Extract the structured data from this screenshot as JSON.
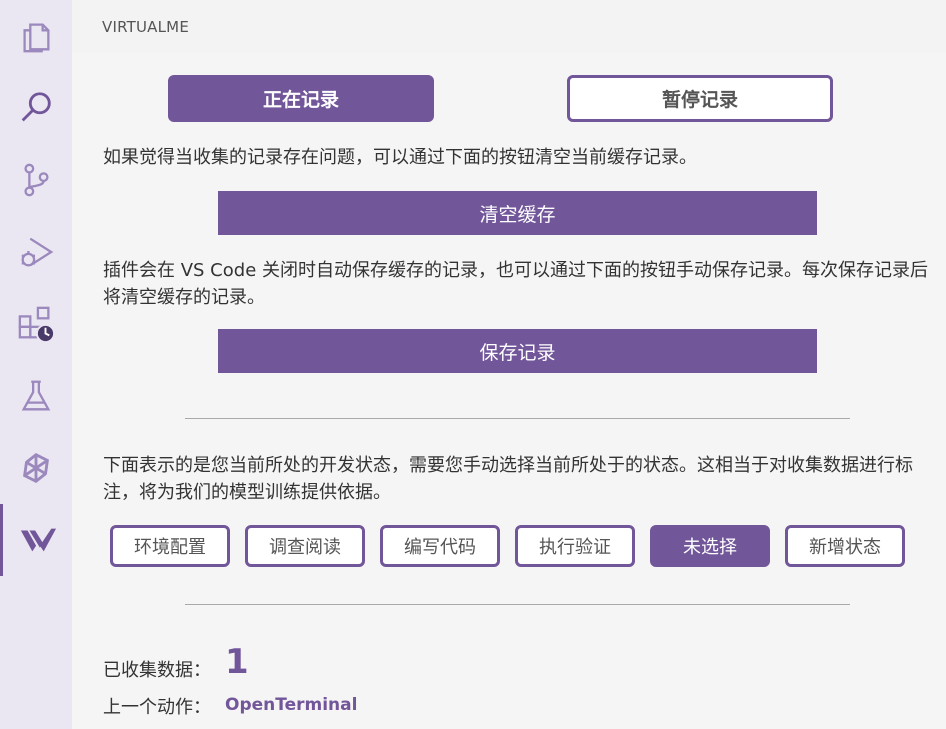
{
  "panel": {
    "title": "VIRTUALME"
  },
  "recording": {
    "start_label": "正在记录",
    "pause_label": "暂停记录"
  },
  "clear": {
    "description": "如果觉得当收集的记录存在问题，可以通过下面的按钮清空当前缓存记录。",
    "button_label": "清空缓存"
  },
  "save": {
    "description": "插件会在 VS Code 关闭时自动保存缓存的记录，也可以通过下面的按钮手动保存记录。每次保存记录后将清空缓存的记录。",
    "button_label": "保存记录"
  },
  "state": {
    "description": "下面表示的是您当前所处的开发状态，需要您手动选择当前所处于的状态。这相当于对收集数据进行标注，将为我们的模型训练提供依据。",
    "options": [
      "环境配置",
      "调查阅读",
      "编写代码",
      "执行验证",
      "未选择",
      "新增状态"
    ],
    "selected": "未选择"
  },
  "stats": {
    "collected_label": "已收集数据：",
    "collected_value": "1",
    "last_action_label": "上一个动作：",
    "last_action_value": "OpenTerminal"
  },
  "activity_bar": {
    "icons": [
      "explorer-icon",
      "search-icon",
      "source-control-icon",
      "run-debug-icon",
      "extensions-icon",
      "testing-icon",
      "remote-icon",
      "virtualme-icon"
    ],
    "active": "virtualme-icon"
  },
  "colors": {
    "accent": "#72569a",
    "icon": "#9b88bd",
    "activity_bg": "#eae6f2"
  }
}
